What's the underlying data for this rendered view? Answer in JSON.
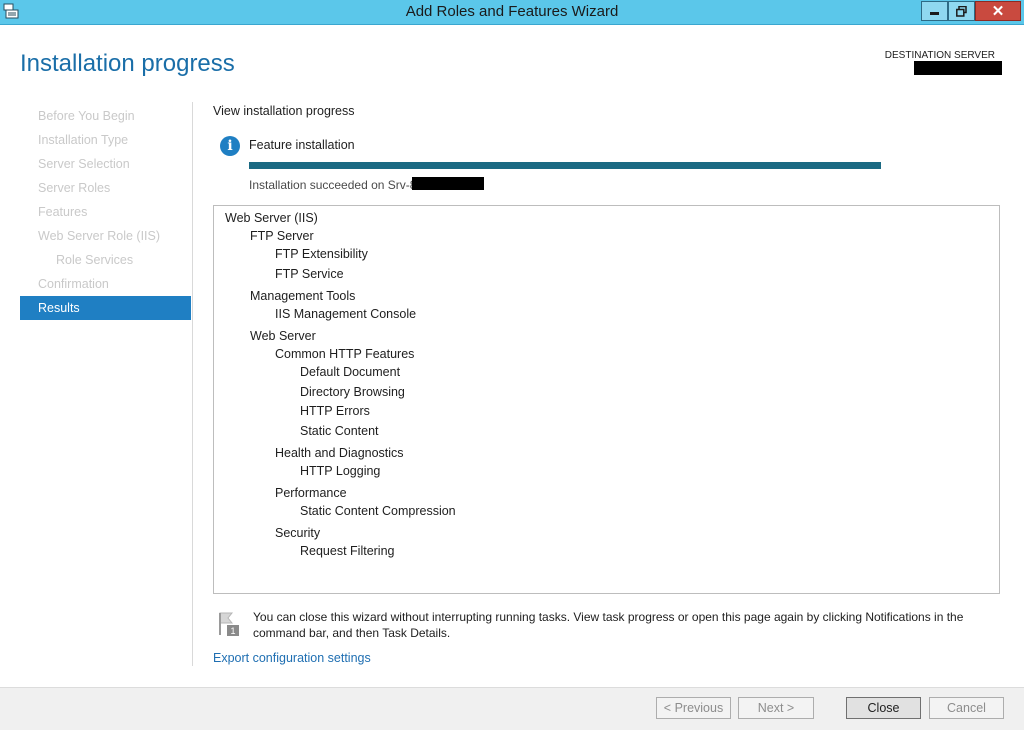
{
  "window": {
    "title": "Add Roles and Features Wizard",
    "close_glyph": "✕"
  },
  "header": {
    "page_title": "Installation progress",
    "destination_label": "DESTINATION SERVER"
  },
  "nav": {
    "items": [
      {
        "label": "Before You Begin",
        "state": "disabled"
      },
      {
        "label": "Installation Type",
        "state": "disabled"
      },
      {
        "label": "Server Selection",
        "state": "disabled"
      },
      {
        "label": "Server Roles",
        "state": "disabled"
      },
      {
        "label": "Features",
        "state": "disabled"
      },
      {
        "label": "Web Server Role (IIS)",
        "state": "disabled"
      },
      {
        "label": "Role Services",
        "state": "disabled"
      },
      {
        "label": "Confirmation",
        "state": "disabled"
      },
      {
        "label": "Results",
        "state": "active"
      }
    ]
  },
  "main": {
    "section_heading": "View installation progress",
    "feature_label": "Feature installation",
    "progress_fraction": 1.0,
    "status_text": "Installation succeeded on Srv-8",
    "tree": [
      {
        "label": "Web Server (IIS)",
        "level": 0
      },
      {
        "label": "FTP Server",
        "level": 1
      },
      {
        "label": "FTP Extensibility",
        "level": 2
      },
      {
        "label": "FTP Service",
        "level": 2
      },
      {
        "label": "Management Tools",
        "level": 1
      },
      {
        "label": "IIS Management Console",
        "level": 2
      },
      {
        "label": "Web Server",
        "level": 1
      },
      {
        "label": "Common HTTP Features",
        "level": 2
      },
      {
        "label": "Default Document",
        "level": 3
      },
      {
        "label": "Directory Browsing",
        "level": 3
      },
      {
        "label": "HTTP Errors",
        "level": 3
      },
      {
        "label": "Static Content",
        "level": 3
      },
      {
        "label": "Health and Diagnostics",
        "level": 2
      },
      {
        "label": "HTTP Logging",
        "level": 3
      },
      {
        "label": "Performance",
        "level": 2
      },
      {
        "label": "Static Content Compression",
        "level": 3
      },
      {
        "label": "Security",
        "level": 2
      },
      {
        "label": "Request Filtering",
        "level": 3
      }
    ],
    "note_text": "You can close this wizard without interrupting running tasks. View task progress or open this page again by clicking Notifications in the command bar, and then Task Details.",
    "note_badge": "1",
    "export_link": "Export configuration settings"
  },
  "buttons": {
    "previous": "< Previous",
    "next": "Next >",
    "close": "Close",
    "cancel": "Cancel"
  },
  "colors": {
    "titlebar": "#5bc7ea",
    "accent": "#1f7fc3",
    "progress": "#1b6a83"
  }
}
